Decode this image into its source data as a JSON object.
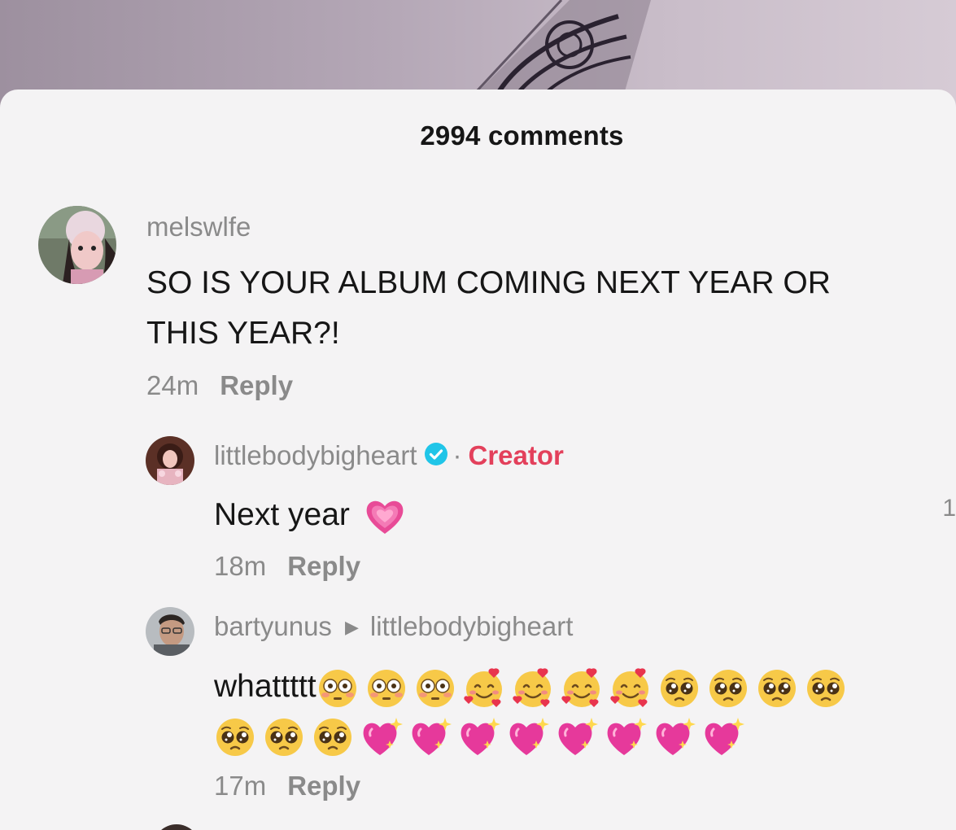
{
  "comments_header": {
    "count_label": "2994 comments"
  },
  "comments": [
    {
      "username": "melswlfe",
      "text_line1": "SO IS YOUR ALBUM COMING NEXT YEAR OR",
      "text_line2": "THIS YEAR?!",
      "time": "24m",
      "reply_label": "Reply"
    },
    {
      "username": "littlebodybigheart",
      "verified": true,
      "separator": "·",
      "role_label": "Creator",
      "text": "Next year",
      "emojis": [
        "growing-heart-emoji"
      ],
      "time": "18m",
      "reply_label": "Reply"
    },
    {
      "username": "bartyunus",
      "reply_to_arrow": "▶",
      "reply_to": "littlebodybigheart",
      "text": "whattttt",
      "emojis_line1": [
        "flushed-face-emoji",
        "flushed-face-emoji",
        "flushed-face-emoji",
        "smiling-face-with-hearts-emoji",
        "smiling-face-with-hearts-emoji",
        "smiling-face-with-hearts-emoji",
        "smiling-face-with-hearts-emoji",
        "pleading-face-emoji",
        "pleading-face-emoji",
        "pleading-face-emoji",
        "pleading-face-emoji"
      ],
      "emojis_line2": [
        "pleading-face-emoji",
        "pleading-face-emoji",
        "pleading-face-emoji",
        "sparkling-heart-emoji",
        "sparkling-heart-emoji",
        "sparkling-heart-emoji",
        "sparkling-heart-emoji",
        "sparkling-heart-emoji",
        "sparkling-heart-emoji",
        "sparkling-heart-emoji",
        "sparkling-heart-emoji"
      ],
      "time": "17m",
      "reply_label": "Reply"
    }
  ],
  "edge_text": "1",
  "colors": {
    "sheet_bg": "#f4f3f4",
    "text_primary": "#161616",
    "text_secondary": "#8a8a8a",
    "creator_accent": "#e3405b",
    "verified_badge": "#20c5e8"
  }
}
